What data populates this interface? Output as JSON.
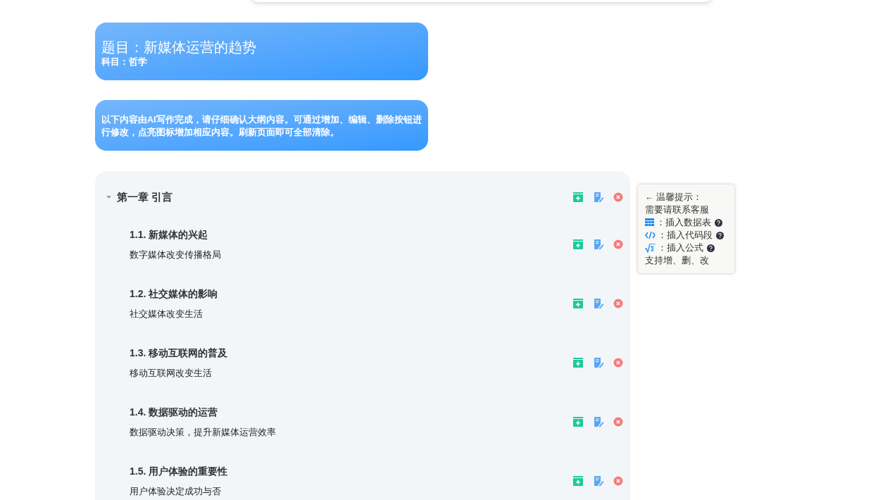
{
  "header": {
    "title": "题目：新媒体运营的趋势",
    "subject": "科目：哲学"
  },
  "notice": "以下内容由AI写作完成，请仔细确认大纲内容。可通过增加、编辑、删除按钮进行修改，点亮图标增加相应内容。刷新页面即可全部清除。",
  "outline": {
    "chapter": {
      "title": "第一章 引言",
      "expanded": true
    },
    "sections": [
      {
        "title": "1.1. 新媒体的兴起",
        "summary": "数字媒体改变传播格局"
      },
      {
        "title": "1.2. 社交媒体的影响",
        "summary": "社交媒体改变生活"
      },
      {
        "title": "1.3. 移动互联网的普及",
        "summary": "移动互联网改变生活"
      },
      {
        "title": "1.4. 数据驱动的运营",
        "summary": "数据驱动决策，提升新媒体运营效率"
      },
      {
        "title": "1.5. 用户体验的重要性",
        "summary": "用户体验决定成功与否"
      }
    ]
  },
  "tips": {
    "heading": "← 温馨提示：",
    "contact": "需要请联系客服",
    "items": [
      {
        "kind": "table",
        "label": "：插入数据表"
      },
      {
        "kind": "code",
        "label": "：插入代码段"
      },
      {
        "kind": "formula",
        "label": "：插入公式"
      }
    ],
    "footer": "支持增、删、改"
  }
}
